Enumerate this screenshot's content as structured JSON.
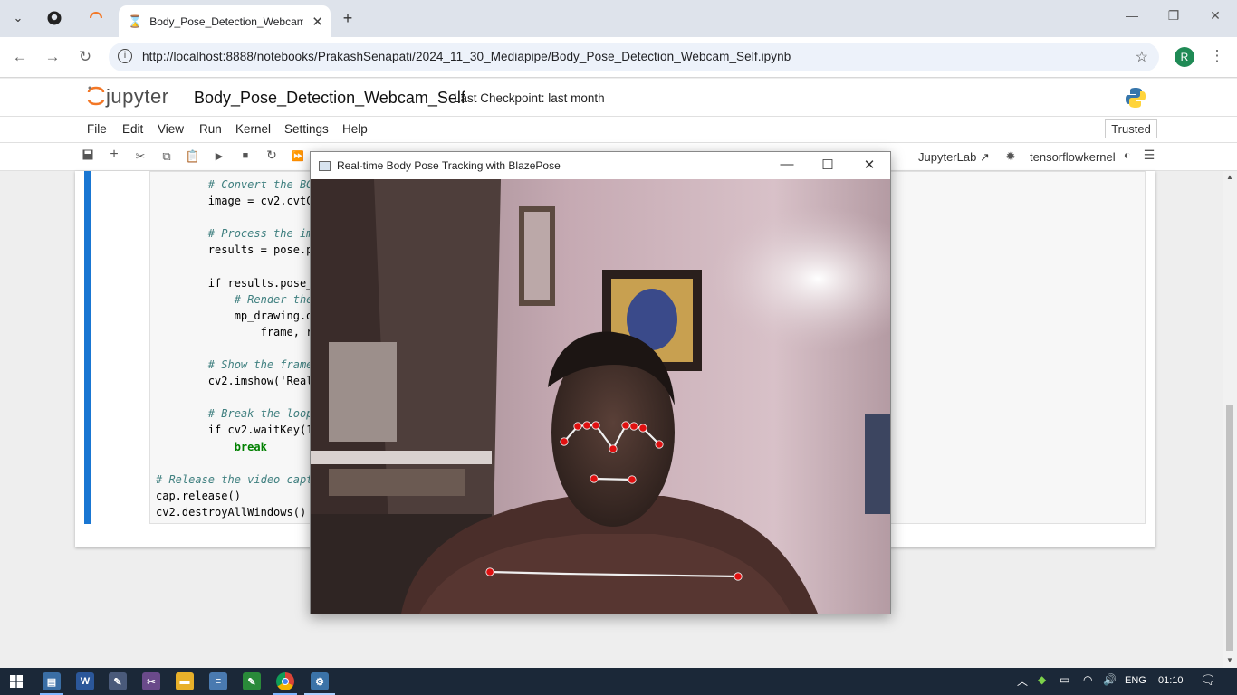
{
  "browser": {
    "tab_title": "Body_Pose_Detection_Webcam_Self.ipynb",
    "url": "http://localhost:8888/notebooks/PrakashSenapati/2024_11_30_Mediapipe/Body_Pose_Detection_Webcam_Self.ipynb",
    "profile_initial": "R"
  },
  "jupyter": {
    "logo_text": "jupyter",
    "notebook_title": "Body_Pose_Detection_Webcam_Self",
    "checkpoint": "Last Checkpoint: last month",
    "menu": [
      "File",
      "Edit",
      "View",
      "Run",
      "Kernel",
      "Settings",
      "Help"
    ],
    "trusted": "Trusted",
    "jupyterlab_link": "JupyterLab",
    "kernel": "tensorflowkernel"
  },
  "code_lines": [
    {
      "indent": "        ",
      "cls": "cm",
      "text": "# Convert the BG"
    },
    {
      "indent": "        ",
      "cls": "",
      "text": "image = cv2.cvtC"
    },
    {
      "indent": "",
      "cls": "",
      "text": ""
    },
    {
      "indent": "        ",
      "cls": "cm",
      "text": "# Process the im"
    },
    {
      "indent": "        ",
      "cls": "",
      "text": "results = pose.p"
    },
    {
      "indent": "",
      "cls": "",
      "text": ""
    },
    {
      "indent": "        ",
      "cls": "",
      "text": "if results.pose_"
    },
    {
      "indent": "            ",
      "cls": "cm",
      "text": "# Render the"
    },
    {
      "indent": "            ",
      "cls": "",
      "text": "mp_drawing.d"
    },
    {
      "indent": "                ",
      "cls": "",
      "text": "frame, r"
    },
    {
      "indent": "",
      "cls": "",
      "text": ""
    },
    {
      "indent": "        ",
      "cls": "cm",
      "text": "# Show the frame"
    },
    {
      "indent": "        ",
      "cls": "",
      "text": "cv2.imshow('Real"
    },
    {
      "indent": "",
      "cls": "",
      "text": ""
    },
    {
      "indent": "        ",
      "cls": "cm",
      "text": "# Break the loop"
    },
    {
      "indent": "        ",
      "cls": "",
      "text": "if cv2.waitKey(1"
    },
    {
      "indent": "            ",
      "cls": "kw",
      "text": "break"
    },
    {
      "indent": "",
      "cls": "",
      "text": ""
    },
    {
      "indent": "",
      "cls": "cm",
      "text": "# Release the video capt"
    },
    {
      "indent": "",
      "cls": "",
      "text": "cap.release()"
    },
    {
      "indent": "",
      "cls": "",
      "text": "cv2.destroyAllWindows()"
    }
  ],
  "cv_window": {
    "title": "Real-time Body Pose Tracking with BlazePose"
  },
  "taskbar": {
    "language": "ENG",
    "time": "01:10"
  },
  "colors": {
    "accent": "#1976d2",
    "landmark": "#e01010",
    "connection": "#f0f0f0"
  }
}
